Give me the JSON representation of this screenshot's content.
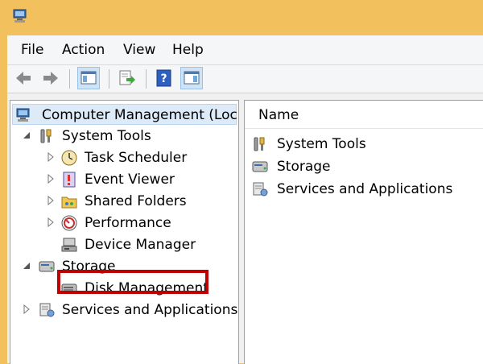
{
  "menu": {
    "file": "File",
    "action": "Action",
    "view": "View",
    "help": "Help"
  },
  "toolbar": {
    "buttons": [
      "back-icon",
      "forward-icon",
      "show-hide-console-tree-icon",
      "export-list-icon",
      "help-icon",
      "show-hide-action-pane-icon"
    ]
  },
  "tree": {
    "root": "Computer Management (Local",
    "system_tools": "System Tools",
    "task_scheduler": "Task Scheduler",
    "event_viewer": "Event Viewer",
    "shared_folders": "Shared Folders",
    "performance": "Performance",
    "device_manager": "Device Manager",
    "storage": "Storage",
    "disk_management": "Disk Management",
    "services_and_applications": "Services and Applications"
  },
  "list": {
    "column_name": "Name",
    "items": [
      "System Tools",
      "Storage",
      "Services and Applications"
    ]
  },
  "colors": {
    "title_bar": "#F2C15E",
    "highlight_border": "#C00000",
    "selection": "#DDEBF8"
  }
}
